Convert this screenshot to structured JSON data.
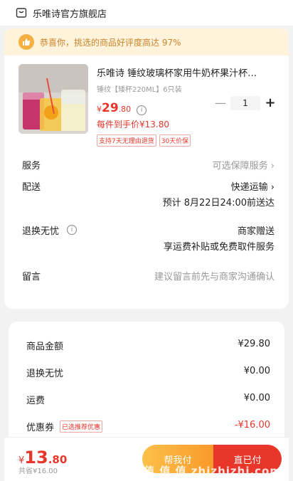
{
  "shop": {
    "name": "乐唯诗官方旗舰店"
  },
  "praise": {
    "text": "恭喜你，挑选的商品好评度高达 97%"
  },
  "product": {
    "title": "乐唯诗 锤纹玻璃杯家用牛奶杯果汁杯…",
    "spec": "锤纹【矮杯220ML】6只装",
    "currency": "¥",
    "price_int": "29",
    "price_dec": ".80",
    "info_icon": "i",
    "quantity": "1",
    "minus_label": "—",
    "plus_label": "+",
    "per_price": "每件到手价¥13.80",
    "tags": [
      "支持7天无理由退货",
      "30天价保"
    ]
  },
  "rows": {
    "service_label": "服务",
    "service_value": "可选保障服务 ›",
    "delivery_label": "配送",
    "delivery_value": "快递运输 ›",
    "delivery_eta": "预计 8月22日24:00前送达",
    "return_label": "退换无忧",
    "return_value": "商家赠送",
    "return_desc": "享运费补贴或免费取件服务",
    "message_label": "留言",
    "message_placeholder": "建议留言前先与商家沟通确认"
  },
  "summary": {
    "goods_label": "商品金额",
    "goods_value": "¥29.80",
    "return_label": "退换无忧",
    "return_value": "¥0.00",
    "shipping_label": "运费",
    "shipping_value": "¥0.00",
    "coupon_label": "优惠券",
    "coupon_badge": "已选推荐优惠",
    "coupon_value": "-¥16.00"
  },
  "footer": {
    "currency": "¥",
    "total_int": "13",
    "total_dec": ".80",
    "saved": "共省¥16.00",
    "help_pay_label": "帮我付",
    "pay_label": "直已付"
  },
  "watermark": "值 值 值 zhizhizhi.com",
  "colors": {
    "accent": "#e8362b",
    "praise_bg": "#fff3dc",
    "praise_text": "#c9852a"
  }
}
